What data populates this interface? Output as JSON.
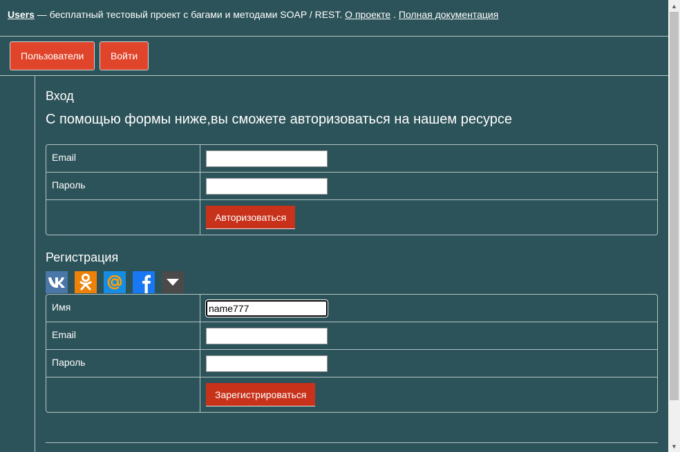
{
  "header": {
    "brand": "Users",
    "description": " — бесплатный тестовый проект с багами и методами SOAP / REST. ",
    "about_link": "О проекте",
    "separator": " . ",
    "docs_link": "Полная документация"
  },
  "nav": {
    "users_button": "Пользователи",
    "login_button": "Войти"
  },
  "login": {
    "title": "Вход",
    "intro": "С помощью формы ниже,вы сможете авторизоваться на нашем ресурсе",
    "email_label": "Email",
    "email_value": "",
    "password_label": "Пароль",
    "password_value": "",
    "submit_label": "Авторизоваться"
  },
  "register": {
    "title": "Регистрация",
    "name_label": "Имя",
    "name_value": "name777",
    "email_label": "Email",
    "email_value": "",
    "password_label": "Пароль",
    "password_value": "",
    "submit_label": "Зарегистрироваться"
  },
  "social": [
    {
      "icon": "vk-icon",
      "color": "#4a76a8"
    },
    {
      "icon": "odnoklassniki-icon",
      "color": "#ee8208"
    },
    {
      "icon": "mailru-icon",
      "color": "#168de2"
    },
    {
      "icon": "facebook-icon",
      "color": "#1877f2"
    },
    {
      "icon": "more-icon",
      "color": "#4a4a4a"
    }
  ],
  "colors": {
    "background": "#2c5359",
    "nav_button": "#e0442a",
    "submit_button": "#c8321b"
  }
}
